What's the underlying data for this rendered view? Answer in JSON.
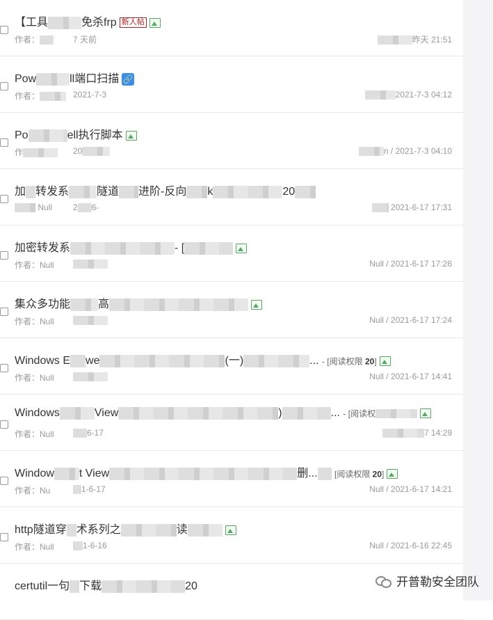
{
  "items": [
    {
      "title": "【工具",
      "title_tail": "免杀frp",
      "badge": "新人帖",
      "author_label": "作者：",
      "author": "",
      "date": "7 天前",
      "last": "昨天 21:51"
    },
    {
      "title": "Pow",
      "title_tail": "ll端口扫描",
      "author_label": "作者：",
      "author": "",
      "date": "2021-7-3",
      "last": "2021-7-3 04:12"
    },
    {
      "title": "Po",
      "title_tail": "ell执行脚本",
      "author_label": "作者：",
      "author": "",
      "date": "20",
      "last": "n / 2021-7-3 04:10"
    },
    {
      "title": "加",
      "title_tail": "转发系",
      "title_mid": "隧道",
      "title_end": "进阶-反向",
      "title_k": "k",
      "title_20": "20",
      "author_label": "作者：",
      "author": "Null",
      "date": "2",
      "date2": "6-",
      "last": "2021-6-17 17:31"
    },
    {
      "title": "加密转发系",
      "title_tail": "- [",
      "author_label": "作者：",
      "author": "Null",
      "date": "",
      "last": "Null / 2021-6-17 17:26"
    },
    {
      "title": "集众多功能",
      "title_tail": "高",
      "author_label": "作者：",
      "author": "Null",
      "date": "",
      "last": "Null / 2021-6-17 17:24"
    },
    {
      "title": "Windows E",
      "title_tail": "we",
      "title_mid": "(一)",
      "title_end": "...",
      "read_prefix": "- [阅读权限",
      "read_level": "20",
      "read_close": "]",
      "author_label": "作者：",
      "author": "Null",
      "date": "",
      "last": "Null / 2021-6-17 14:41"
    },
    {
      "title": "Windows",
      "title_tail": "View",
      "title_mid": ")",
      "title_end": "...",
      "read_prefix": "- [阅读权",
      "author_label": "作者：",
      "author": "Null",
      "date": "6-17",
      "last": "7 14:29"
    },
    {
      "title": "Window",
      "title_tail": "t View",
      "title_mid": "删...",
      "read_prefix": "[阅读权限",
      "read_level": "20",
      "read_close": "]",
      "author_label": "作者：",
      "author": "Nu",
      "date": "1-6-17",
      "last": "Null / 2021-6-17 14:21"
    },
    {
      "title": "http隧道穿",
      "title_tail": "术系列之",
      "title_mid": "读",
      "author_label": "作者：",
      "author": "Null",
      "date": "1-6-16",
      "last": "Null / 2021-6-16 22:45"
    },
    {
      "title": "certutil一句",
      "title_tail": "下载",
      "title_mid": "20"
    }
  ],
  "watermark": "开普勒安全团队"
}
